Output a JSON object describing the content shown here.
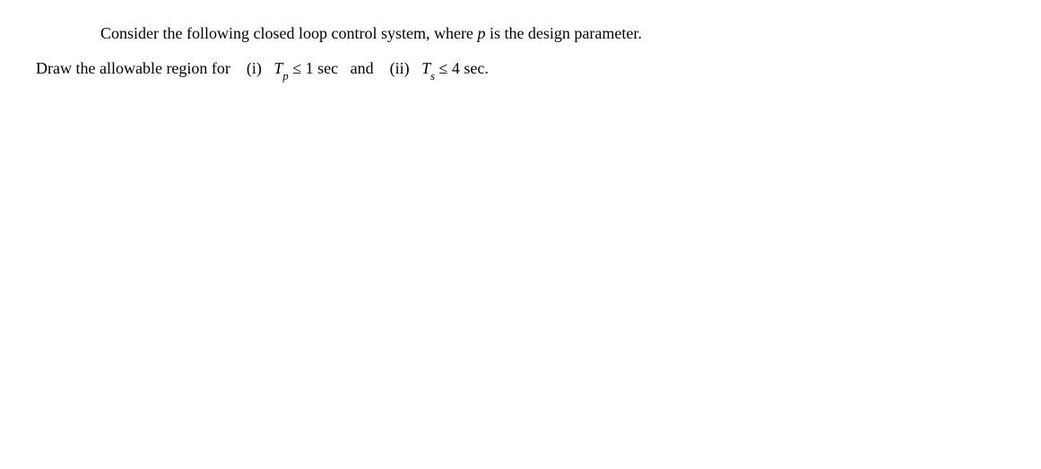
{
  "problem": {
    "line1_pre": "Consider the following closed loop control system, where ",
    "line1_var": "p",
    "line1_post": " is the design parameter.",
    "line2_pre": "Draw the allowable region for    (i)   ",
    "cond1_var": "T",
    "cond1_sub": "p",
    "cond1_rel": " ≤ 1 sec",
    "line2_mid": "   and    (ii)   ",
    "cond2_var": "T",
    "cond2_sub": "s",
    "cond2_rel": " ≤ 4 sec."
  }
}
